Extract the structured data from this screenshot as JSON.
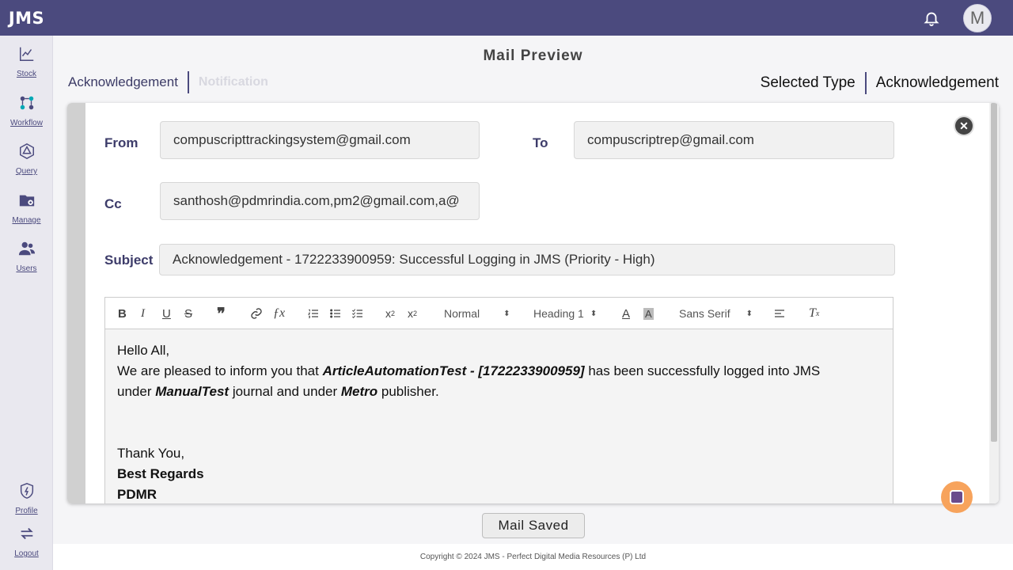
{
  "app": {
    "logo": "JMS"
  },
  "header": {
    "avatar_letter": "M"
  },
  "sidebar": {
    "items": [
      {
        "label": "Stock",
        "icon": "chart-line-icon"
      },
      {
        "label": "Workflow",
        "icon": "workflow-icon"
      },
      {
        "label": "Query",
        "icon": "query-icon"
      },
      {
        "label": "Manage",
        "icon": "folder-gear-icon"
      },
      {
        "label": "Users",
        "icon": "users-icon"
      }
    ],
    "bottom": [
      {
        "label": "Profile",
        "icon": "shield-bolt-icon"
      },
      {
        "label": "Logout",
        "icon": "logout-icon"
      }
    ]
  },
  "page": {
    "title": "Mail Preview"
  },
  "tabs": [
    {
      "label": "Acknowledgement",
      "active": true
    },
    {
      "label": "Notification",
      "active": false
    }
  ],
  "selected_type": {
    "label": "Selected Type",
    "value": "Acknowledgement"
  },
  "mail": {
    "from_label": "From",
    "from_value": "compuscripttrackingsystem@gmail.com",
    "to_label": "To",
    "to_value": "compuscriptrep@gmail.com",
    "cc_label": "Cc",
    "cc_value": "santhosh@pdmrindia.com,pm2@gmail.com,a@",
    "subject_label": "Subject",
    "subject_value": "Acknowledgement - 1722233900959: Successful Logging in JMS (Priority - High)"
  },
  "toolbar": {
    "size_select": "Normal",
    "heading_select": "Heading 1",
    "font_select": "Sans Serif"
  },
  "body": {
    "greeting": "Hello All,",
    "line1_pre": "We are pleased to inform you that ",
    "article": "ArticleAutomationTest - [1722233900959]",
    "line1_post": " has been successfully logged into JMS",
    "line2_pre": "under ",
    "journal": "ManualTest",
    "line2_mid": " journal and under ",
    "publisher": "Metro",
    "line2_post": " publisher.",
    "thanks": "Thank You,",
    "regards": "Best Regards",
    "signature": "PDMR"
  },
  "status_button": "Mail Saved",
  "footer": {
    "copyright": "Copyright © 2024 JMS - Perfect Digital Media Resources (P) Ltd"
  },
  "colors": {
    "primary": "#4b4a7e",
    "accent": "#f7a35c"
  }
}
